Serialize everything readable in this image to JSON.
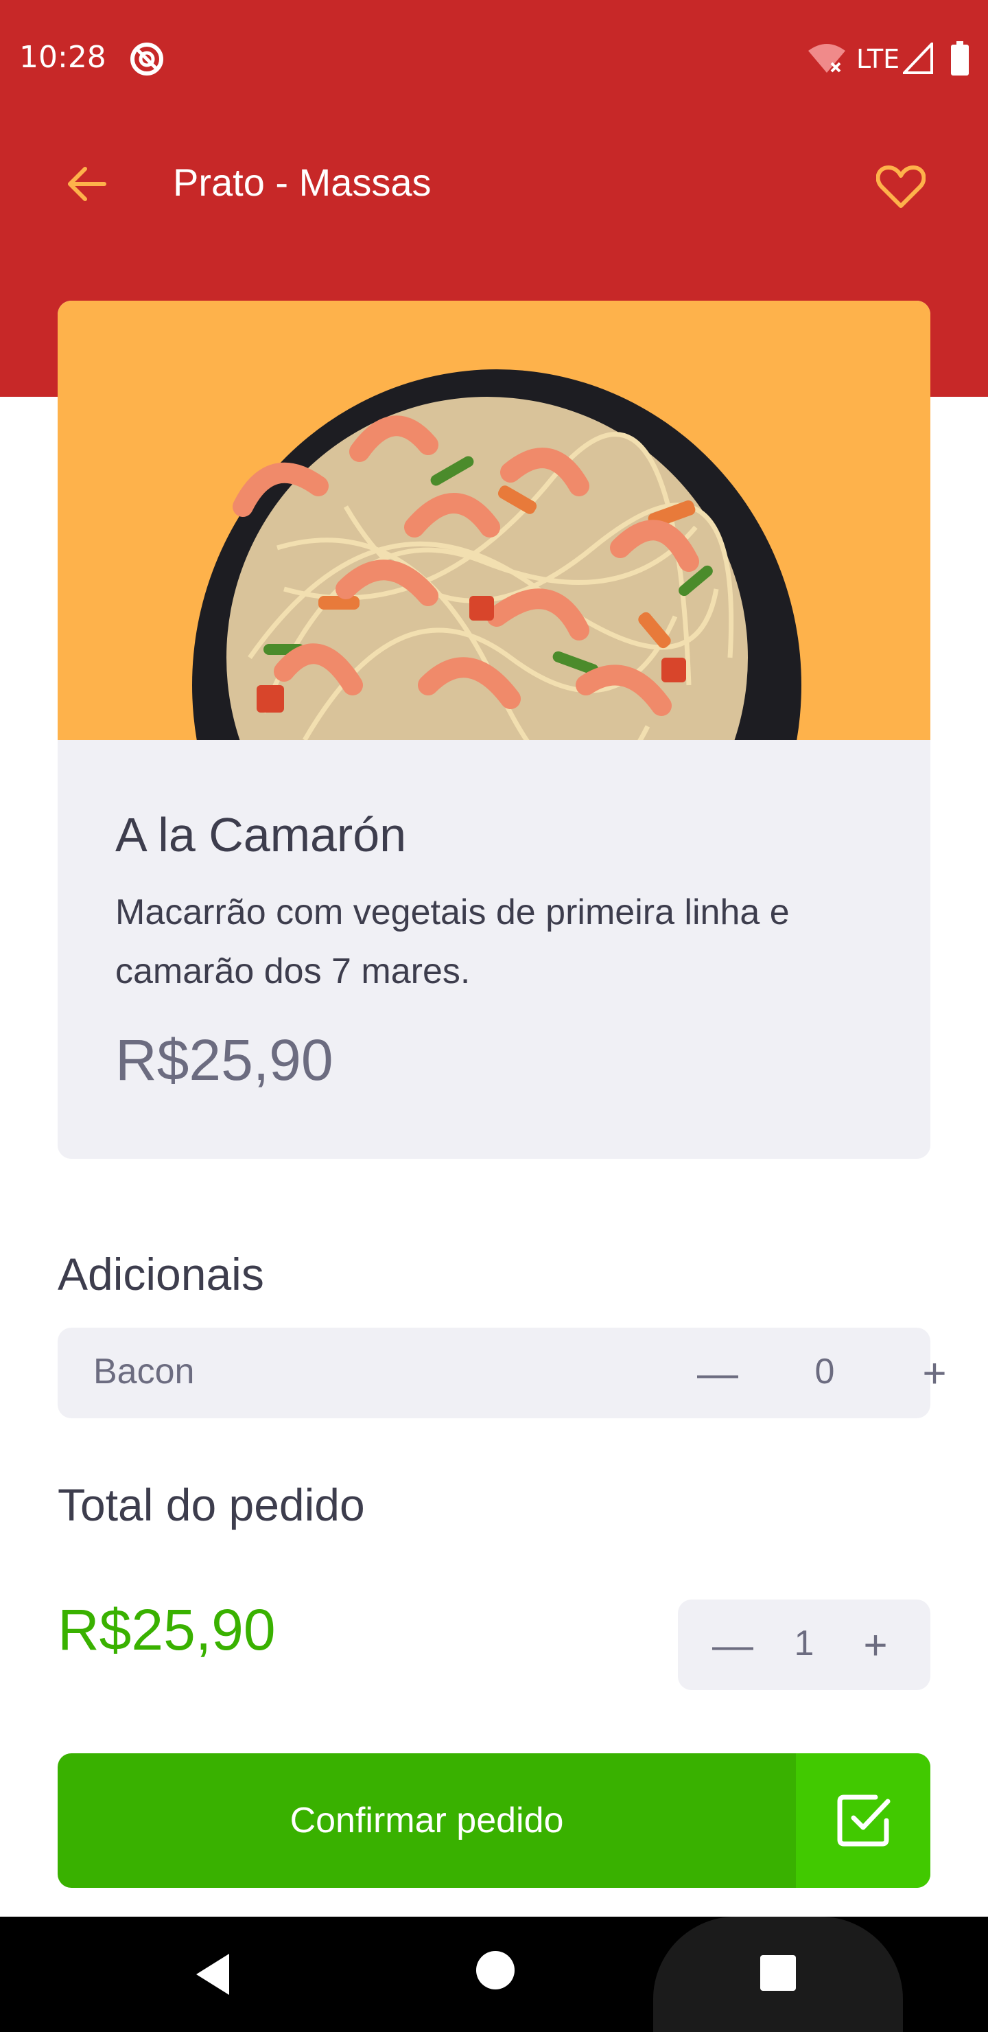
{
  "status_bar": {
    "time": "10:28",
    "network": "LTE"
  },
  "app_bar": {
    "title": "Prato - Massas",
    "back_icon": "arrow-left-icon",
    "favorite_icon": "heart-outline-icon"
  },
  "dish": {
    "name": "A la Camarón",
    "description": "Macarrão com vegetais de primeira linha e camarão dos 7 mares.",
    "price": "R$25,90"
  },
  "additionals": {
    "section_title": "Adicionais",
    "items": [
      {
        "name": "Bacon",
        "quantity": "0",
        "minus": "—",
        "plus": "+"
      }
    ]
  },
  "order_total": {
    "section_title": "Total do pedido",
    "total": "R$25,90",
    "quantity": "1",
    "minus": "—",
    "plus": "+"
  },
  "confirm": {
    "label": "Confirmar pedido",
    "icon": "check-square-icon"
  },
  "colors": {
    "header_red": "#c72828",
    "accent_yellow": "#feb24b",
    "green": "#39b100",
    "green_light": "#41c900",
    "card_bg": "#f0f0f5"
  }
}
